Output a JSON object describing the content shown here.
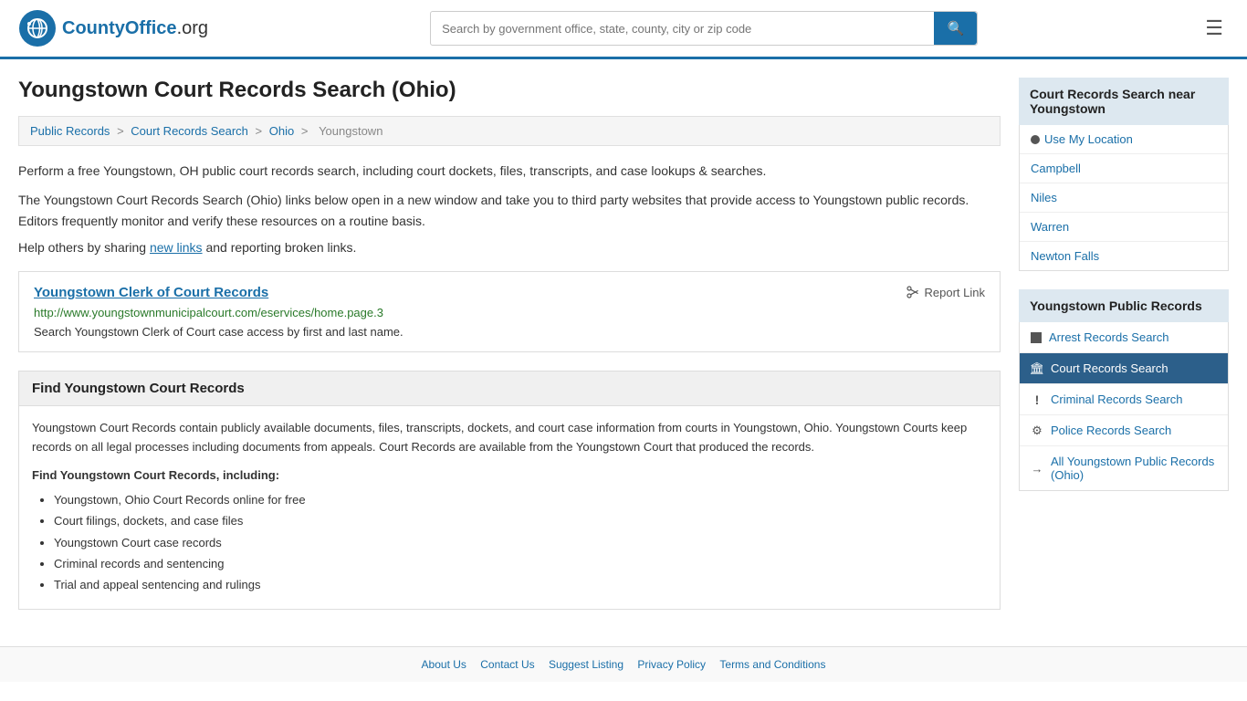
{
  "header": {
    "logo_text": "CountyOffice",
    "logo_suffix": ".org",
    "search_placeholder": "Search by government office, state, county, city or zip code"
  },
  "breadcrumb": {
    "items": [
      "Public Records",
      "Court Records Search",
      "Ohio",
      "Youngstown"
    ]
  },
  "page": {
    "title": "Youngstown Court Records Search (Ohio)",
    "intro": "Perform a free Youngstown, OH public court records search, including court dockets, files, transcripts, and case lookups & searches.",
    "third_party": "The Youngstown Court Records Search (Ohio) links below open in a new window and take you to third party websites that provide access to Youngstown public records. Editors frequently monitor and verify these resources on a routine basis.",
    "help": "Help others by sharing",
    "new_links": "new links",
    "and_reporting": "and reporting broken links."
  },
  "link_card": {
    "title": "Youngstown Clerk of Court Records",
    "url": "http://www.youngstownmunicipalcourt.com/eservices/home.page.3",
    "description": "Search Youngstown Clerk of Court case access by first and last name.",
    "report_label": "Report Link"
  },
  "find_section": {
    "header": "Find Youngstown Court Records",
    "description": "Youngstown Court Records contain publicly available documents, files, transcripts, dockets, and court case information from courts in Youngstown, Ohio. Youngstown Courts keep records on all legal processes including documents from appeals. Court Records are available from the Youngstown Court that produced the records.",
    "including_header": "Find Youngstown Court Records, including:",
    "items": [
      "Youngstown, Ohio Court Records online for free",
      "Court filings, dockets, and case files",
      "Youngstown Court case records",
      "Criminal records and sentencing",
      "Trial and appeal sentencing and rulings"
    ]
  },
  "sidebar": {
    "nearby_title": "Court Records Search near Youngstown",
    "use_location": "Use My Location",
    "nearby_cities": [
      "Campbell",
      "Niles",
      "Warren",
      "Newton Falls"
    ],
    "public_records_title": "Youngstown Public Records",
    "public_records_items": [
      {
        "label": "Arrest Records Search",
        "active": false,
        "icon": "square"
      },
      {
        "label": "Court Records Search",
        "active": true,
        "icon": "building"
      },
      {
        "label": "Criminal Records Search",
        "active": false,
        "icon": "exclamation"
      },
      {
        "label": "Police Records Search",
        "active": false,
        "icon": "gear"
      },
      {
        "label": "All Youngstown Public Records (Ohio)",
        "active": false,
        "icon": "arrow"
      }
    ]
  },
  "footer": {
    "links": [
      "About Us",
      "Contact Us",
      "Suggest Listing",
      "Privacy Policy",
      "Terms and Conditions"
    ]
  }
}
